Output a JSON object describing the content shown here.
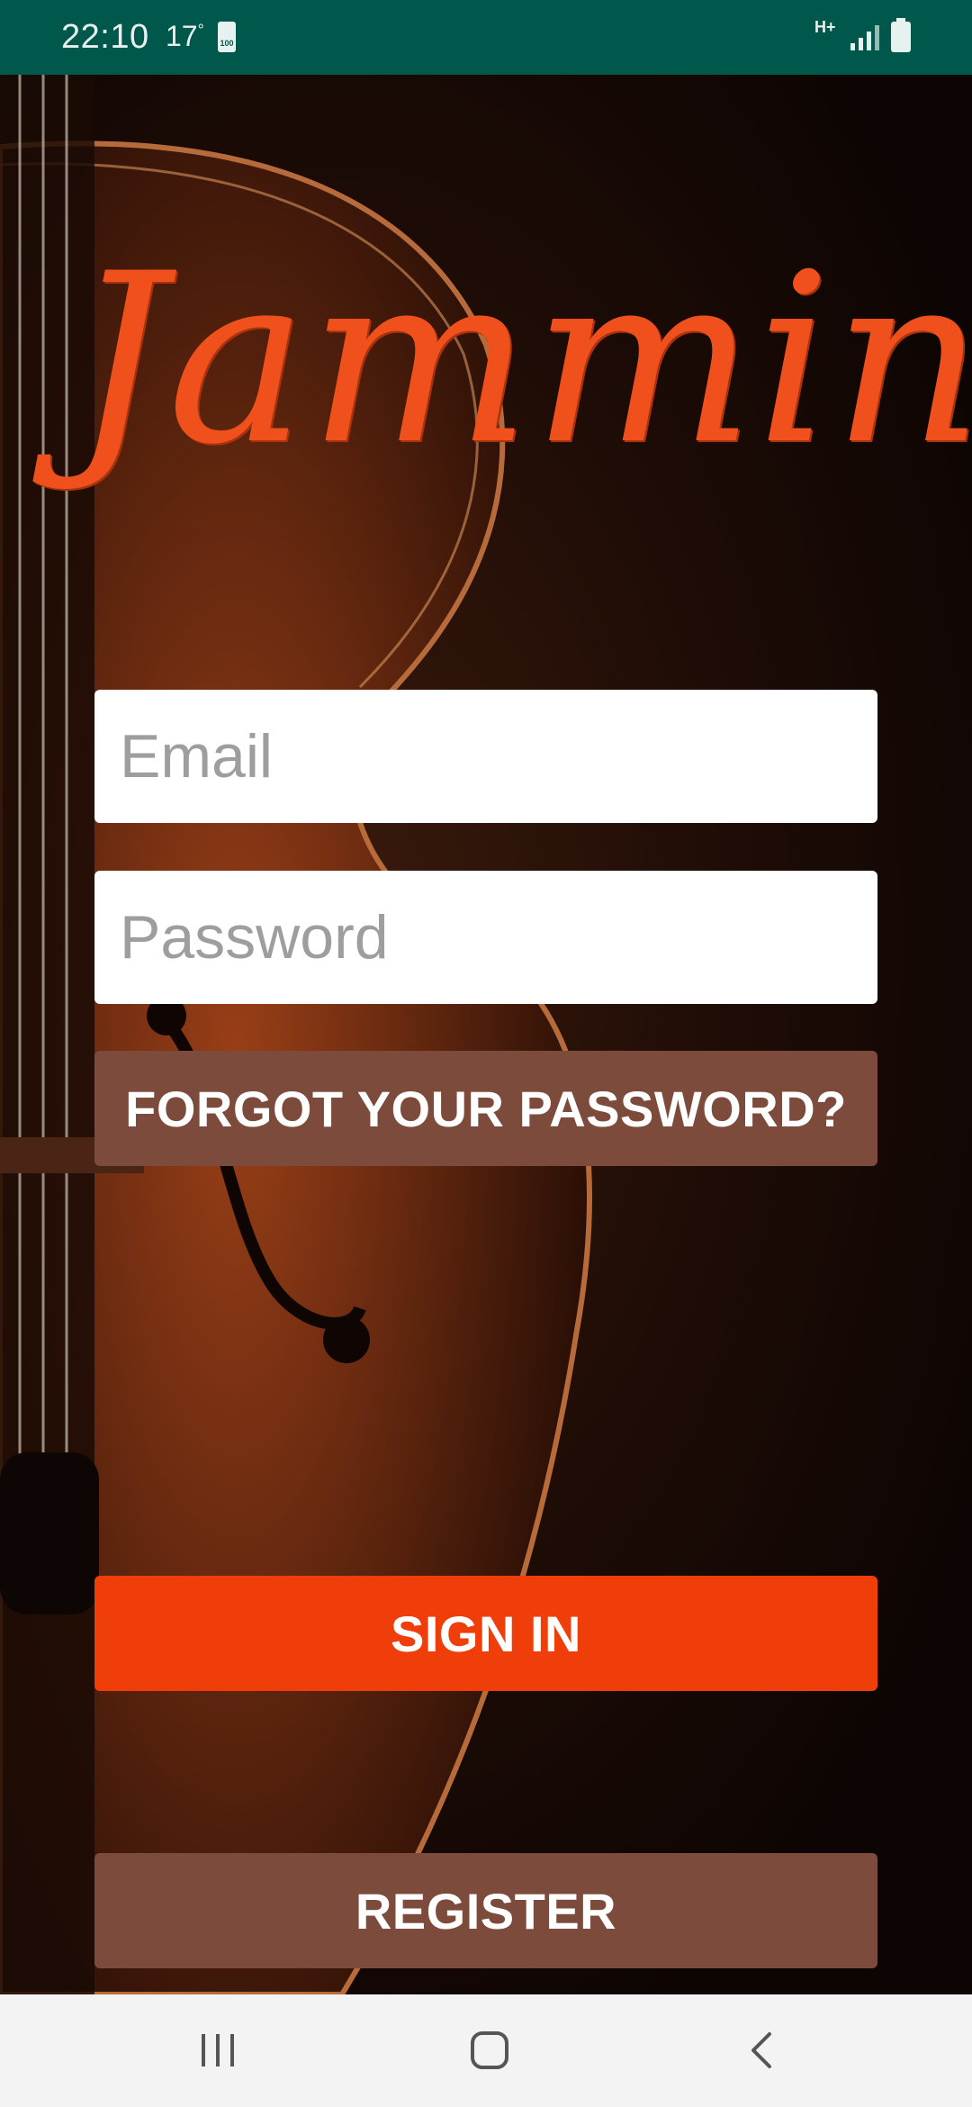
{
  "status_bar": {
    "time": "22:10",
    "temperature": "17",
    "temperature_unit": "°",
    "battery_saver_label": "100",
    "network_type": "H+"
  },
  "app": {
    "logo_text": "Jammin",
    "accent_color": "#f03e0a",
    "secondary_color": "#7d4b3c"
  },
  "form": {
    "email_placeholder": "Email",
    "email_value": "",
    "password_placeholder": "Password",
    "password_value": "",
    "forgot_label": "FORGOT YOUR PASSWORD?",
    "signin_label": "SIGN IN",
    "register_label": "REGISTER"
  },
  "nav": {
    "recents_icon": "recents-icon",
    "home_icon": "home-icon",
    "back_icon": "back-icon"
  }
}
